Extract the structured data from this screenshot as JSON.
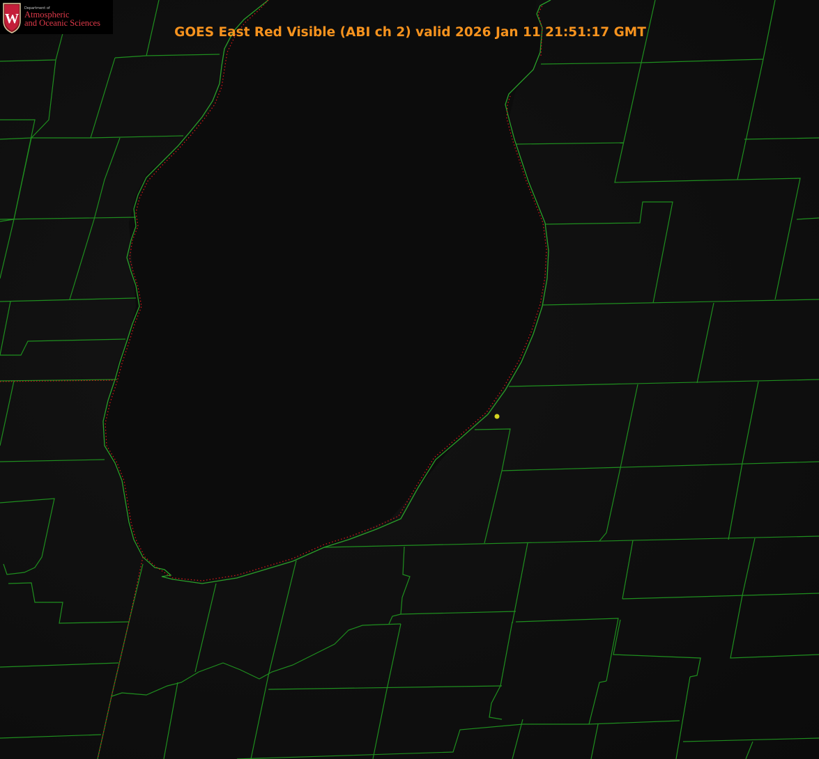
{
  "header": {
    "title": "GOES East Red Visible (ABI ch 2) valid 2026 Jan 11 21:51:17 GMT"
  },
  "logo": {
    "department": "Department of",
    "line1": "Atmospheric",
    "line2": "and Oceanic Sciences",
    "seal_letter": "W",
    "seal_color": "#c41e3a"
  },
  "map": {
    "background_color": "#101010",
    "county_line_color": "#1f8f1f",
    "coastline_color": "#2aa02a",
    "state_border_color": "#d01818",
    "marker_color": "#d4d421"
  }
}
